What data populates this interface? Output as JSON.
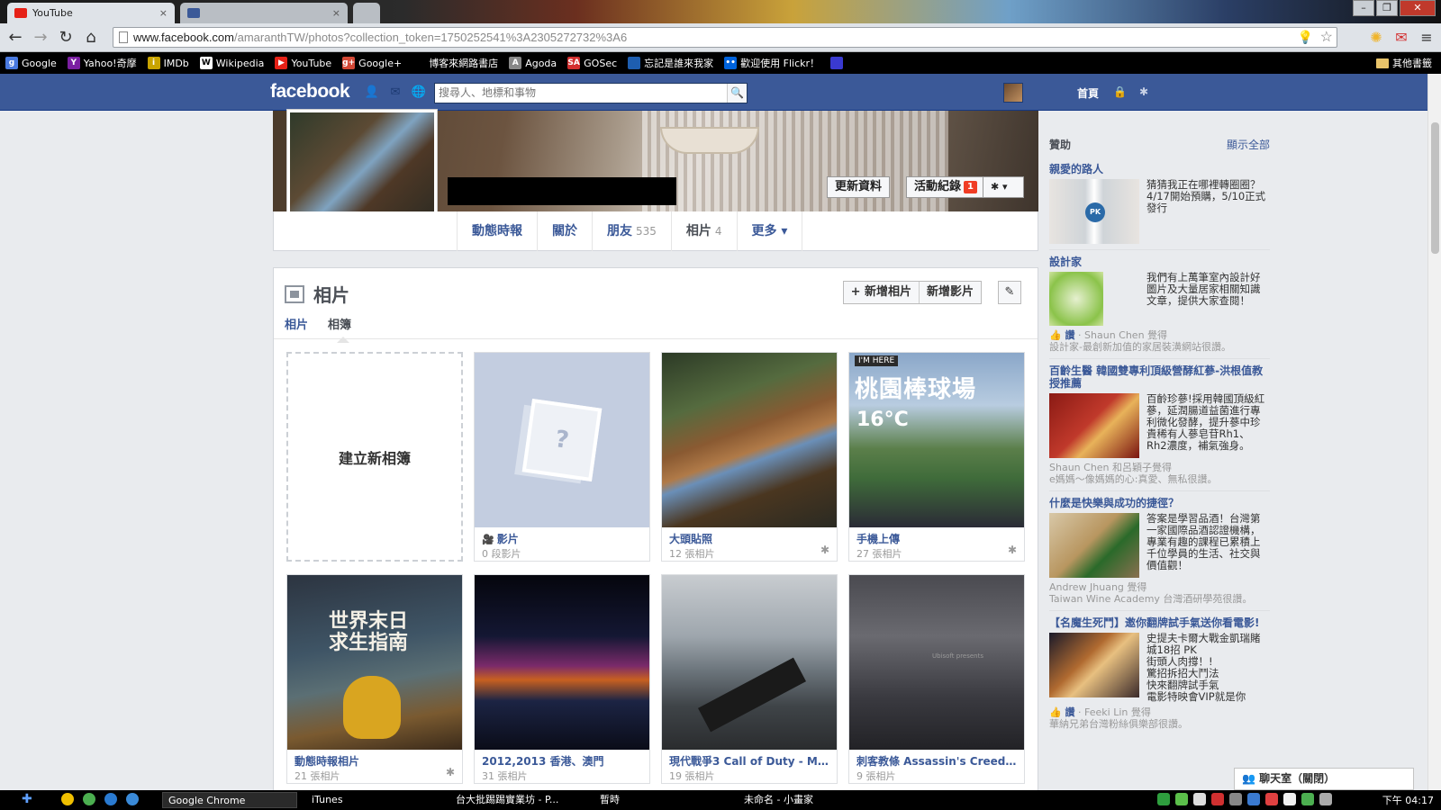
{
  "browser": {
    "tabs": [
      {
        "label": "YouTube",
        "close": "×"
      },
      {
        "label": "",
        "close": "×"
      }
    ],
    "url_host": "www.facebook.com",
    "url_rest": "/amaranthTW/photos?collection_token=1750252541%3A2305272732%3A6",
    "bookmarks": [
      {
        "label": "Google",
        "color": "#4a7ae0",
        "glyph": "g"
      },
      {
        "label": "Yahoo!奇摩",
        "color": "#7b1fa2",
        "glyph": "Y"
      },
      {
        "label": "IMDb",
        "color": "#c9a400",
        "glyph": "i"
      },
      {
        "label": "Wikipedia",
        "color": "#ffffff",
        "glyph": "W"
      },
      {
        "label": "YouTube",
        "color": "#e62117",
        "glyph": "▶"
      },
      {
        "label": "Google+",
        "color": "#d34836",
        "glyph": "g+"
      },
      {
        "label": "博客來網路書店",
        "color": "#000000",
        "glyph": ""
      },
      {
        "label": "Agoda",
        "color": "#888888",
        "glyph": "A"
      },
      {
        "label": "GOSec",
        "color": "#d32f2f",
        "glyph": "SA"
      },
      {
        "label": "忘記是誰來我家",
        "color": "#1e5eb0",
        "glyph": ""
      },
      {
        "label": "歡迎使用 Flickr！",
        "color": "#0063dc",
        "glyph": "••"
      },
      {
        "label": "",
        "color": "#3a3ad0",
        "glyph": ""
      }
    ],
    "other_bookmarks": "其他書籤"
  },
  "fb": {
    "logo": "facebook",
    "search_placeholder": "搜尋人、地標和事物",
    "home": "首頁"
  },
  "profile": {
    "update_info": "更新資料",
    "activity_log": "活動紀錄",
    "activity_badge": "1",
    "settings": "✱ ▾",
    "tabs": [
      {
        "label": "動態時報",
        "count": ""
      },
      {
        "label": "關於",
        "count": ""
      },
      {
        "label": "朋友",
        "count": "535"
      },
      {
        "label": "相片",
        "count": "4"
      },
      {
        "label": "更多 ▾",
        "count": ""
      }
    ]
  },
  "photos": {
    "title": "相片",
    "add_photo": "+ 新增相片",
    "add_video": "新增影片",
    "subtab_photos": "相片",
    "subtab_albums": "相簿",
    "create_album": "建立新相簿",
    "albums": [
      {
        "title": "影片",
        "count": "0 段影片"
      },
      {
        "title": "大頭貼照",
        "count": "12 張相片"
      },
      {
        "title": "手機上傳",
        "count": "27 張相片",
        "overlay": "桃園棒球場",
        "temp": "16°C",
        "tag": "I'M HERE"
      },
      {
        "title": "動態時報相片",
        "count": "21 張相片",
        "book": "世界末日\n求生指南"
      },
      {
        "title": "2012,2013 香港、澳門",
        "count": "31 張相片"
      },
      {
        "title": "現代戰爭3 Call of Duty - M...",
        "count": "19 張相片"
      },
      {
        "title": "刺客教條 Assassin's Creed II",
        "count": "9 張相片",
        "ubisoft": "Ubisoft presents"
      }
    ]
  },
  "rhc": {
    "sponsored": "贊助",
    "show_all": "顯示全部",
    "ads": [
      {
        "title": "親愛的路人",
        "text": "猜猜我正在哪裡轉圈圈？4/17開始預購，5/10正式發行",
        "like": "",
        "like_text": "",
        "pk": "PK"
      },
      {
        "title": "設計家",
        "text": "我們有上萬筆室內設計好圖片及大量居家相關知識文章，提供大家查閱！",
        "like": "讚",
        "like_text": "· Shaun Chen 覺得\n設計家-最創新加值的家居裝潢網站很讚。"
      },
      {
        "title": "百齡生醫 韓國雙專利頂級營酵紅蔘-洪根值教授推薦",
        "text": "百齡珍蔘!採用韓國頂級紅蔘，延潤腸道益菌進行專利微化發酵，提升蔘中珍貴稀有人蔘皂苷Rh1、Rh2濃度，補氣強身。",
        "like": "",
        "like_text": "Shaun Chen 和呂穎子覺得\ne媽媽～像媽媽的心:真愛、無私很讚。"
      },
      {
        "title": "什麼是快樂與成功的捷徑？",
        "text": "答案是學習品酒！台灣第一家國際品酒認證機構，專業有趣的課程已累積上千位學員的生活、社交與價值觀！",
        "like": "",
        "like_text": "Andrew Jhuang 覺得\nTaiwan Wine Academy 台灣酒研學苑很讚。"
      },
      {
        "title": "【名魔生死鬥】邀你翻牌試手氣送你看電影!",
        "text": "史提夫卡爾大戰金凱瑞賭城18招 PK\n街頭人肉撐！!\n驚招拆招大鬥法\n快來翻牌試手氣\n電影特映會VIP就是你",
        "like": "讚",
        "like_text": "· Feeki Lin 覺得\n華納兄弟台灣粉絲俱樂部很讚。"
      }
    ]
  },
  "chat": "聊天室（關閉）",
  "taskbar": {
    "tasks": [
      "Google Chrome",
      "iTunes",
      "台大批踢踢實業坊 - P...",
      "暫時",
      "未命名 - 小畫家"
    ],
    "clock": "下午 04:17"
  }
}
